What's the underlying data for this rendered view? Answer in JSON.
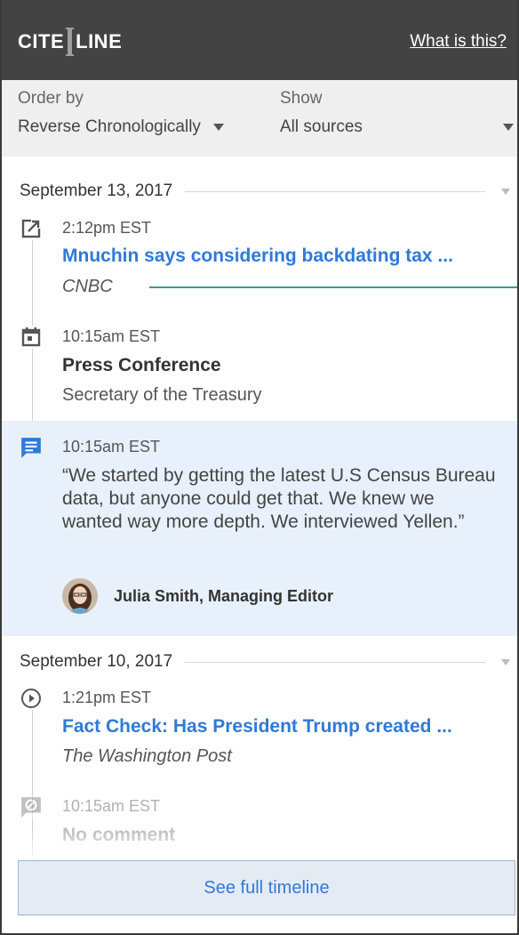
{
  "header": {
    "logo_left": "CITE",
    "logo_right": "LINE",
    "what_link": "What is this?"
  },
  "filters": {
    "order_label": "Order by",
    "order_value": "Reverse Chronologically",
    "show_label": "Show",
    "show_value": "All sources"
  },
  "groups": [
    {
      "date": "September 13, 2017",
      "items": [
        {
          "icon": "external-link-icon",
          "time": "2:12pm EST",
          "title": "Mnuchin says considering backdating tax ...",
          "source": "CNBC"
        },
        {
          "icon": "calendar-icon",
          "time": "10:15am EST",
          "title": "Press Conference",
          "subtitle": "Secretary of the Treasury"
        },
        {
          "icon": "comment-icon",
          "time": "10:15am EST",
          "quote": "“We started by getting the latest U.S Census Bureau data, but anyone could get that. We knew we wanted way more depth. We interviewed Yellen.”",
          "author": "Julia Smith, Managing Editor"
        }
      ]
    },
    {
      "date": "September 10, 2017",
      "items": [
        {
          "icon": "play-circle-icon",
          "time": "1:21pm EST",
          "title": "Fact Check: Has President Trump created ...",
          "source": "The Washington Post"
        },
        {
          "icon": "no-comment-icon",
          "time": "10:15am EST",
          "title": "No comment"
        }
      ]
    }
  ],
  "footer": {
    "see_full_label": "See full timeline"
  },
  "colors": {
    "header_bg": "#434343",
    "link_blue": "#2f7ad8",
    "highlight_bg": "#e8f0fb",
    "teal_accent": "#3a9b95"
  }
}
